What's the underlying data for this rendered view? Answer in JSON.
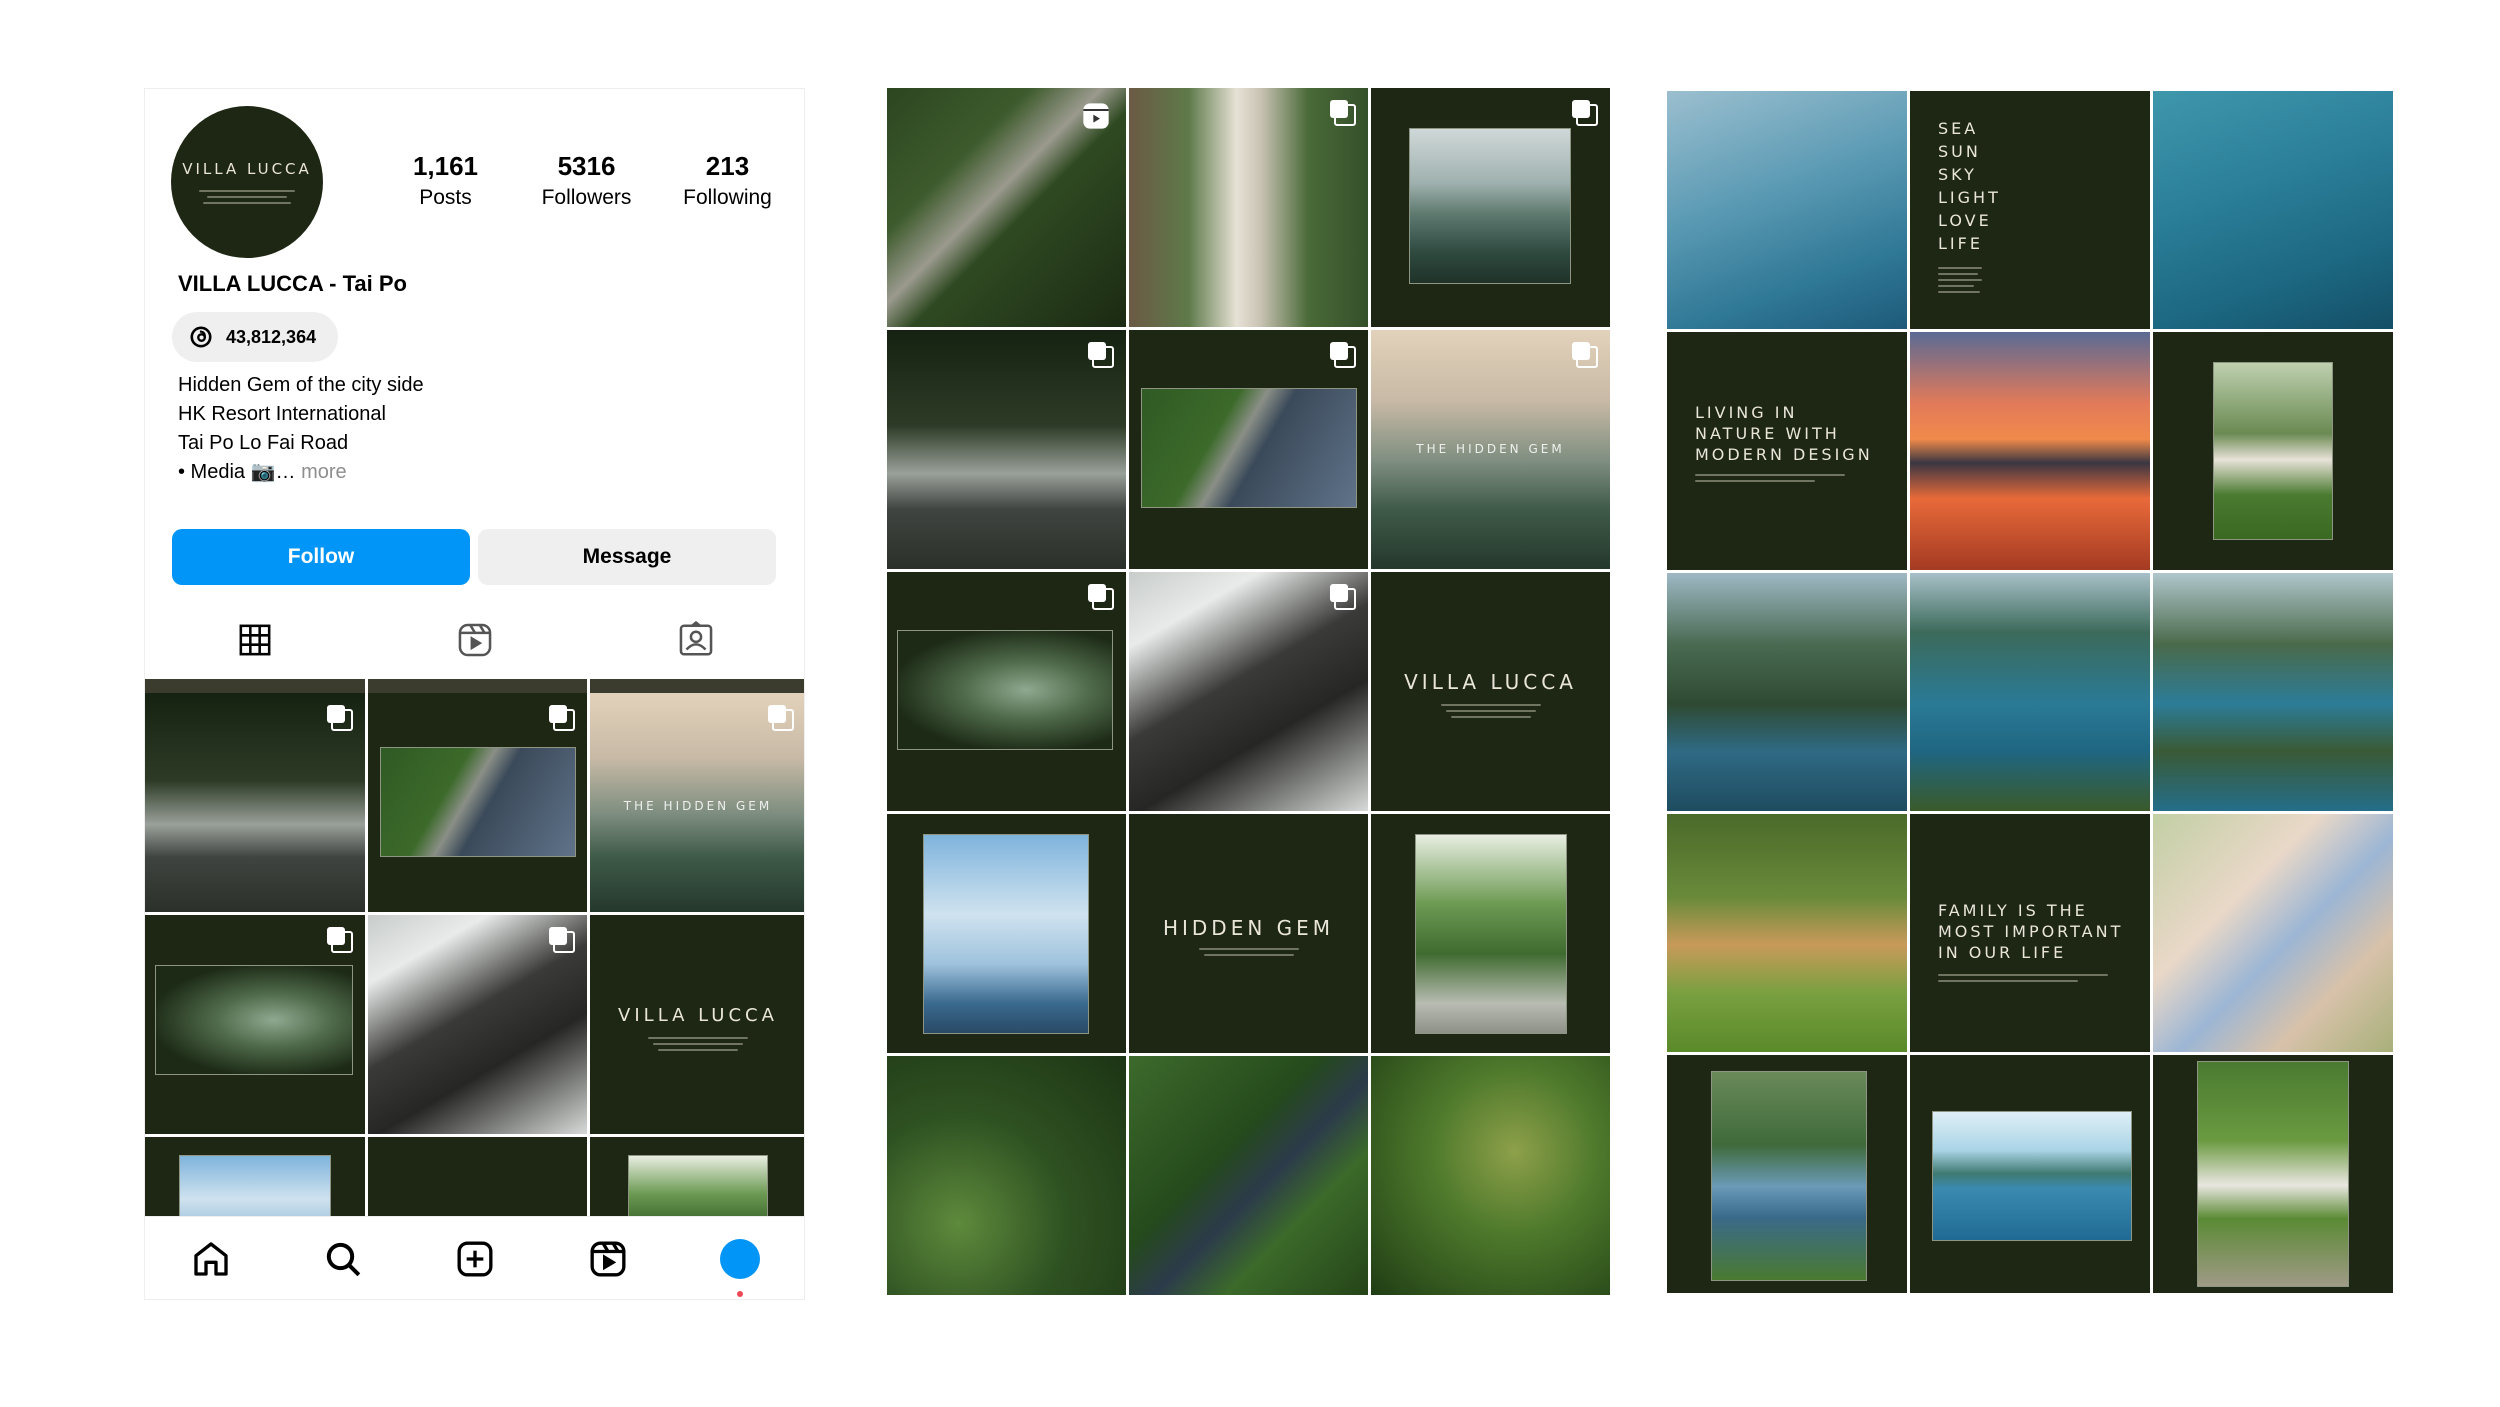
{
  "profile": {
    "avatar_text": "VILLA LUCCA",
    "name": "VILLA LUCCA - Tai Po",
    "stats": [
      {
        "value": "1,161",
        "label": "Posts"
      },
      {
        "value": "5316",
        "label": "Followers"
      },
      {
        "value": "213",
        "label": "Following"
      }
    ],
    "threads_count": "43,812,364",
    "bio": {
      "line1": "Hidden Gem of the city side",
      "line2": "HK Resort International",
      "line3": "Tai Po Lo Fai Road",
      "line4": "• Media 📷…",
      "more": "more"
    },
    "follow_label": "Follow",
    "message_label": "Message"
  },
  "tabs": [
    "grid-icon",
    "reels-icon",
    "tagged-icon"
  ],
  "nav": [
    "home-icon",
    "search-icon",
    "create-icon",
    "reels-icon",
    "profile-avatar"
  ],
  "tile_text": {
    "hidden_gem_overlay": "THE HIDDEN GEM",
    "villa_lucca": "VILLA LUCCA",
    "hidden_gem": "HIDDEN GEM",
    "sea_list": "SEA\nSUN\nSKY\nLIGHT\nLOVE\nLIFE",
    "living": "LIVING IN\nNATURE WITH\nMODERN DESIGN",
    "family": "FAMILY IS THE\nMOST IMPORTANT\nIN OUR LIFE"
  },
  "colors": {
    "accent_blue": "#0095f6",
    "brand_dark_green": "#1e2614",
    "notification_dot": "#ed4956"
  }
}
